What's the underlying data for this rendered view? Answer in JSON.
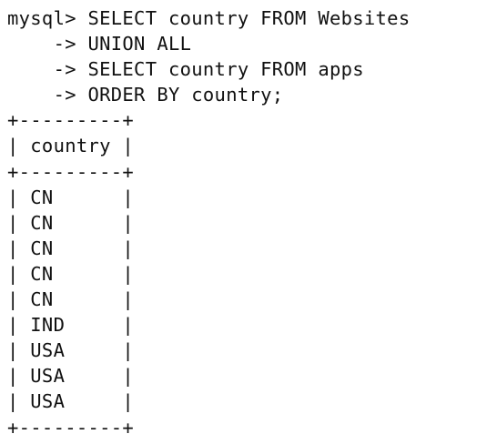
{
  "query_lines": [
    "mysql> SELECT country FROM Websites",
    "    -> UNION ALL",
    "    -> SELECT country FROM apps",
    "    -> ORDER BY country;"
  ],
  "table": {
    "border": "+---------+",
    "header_row": "| country |",
    "rows": [
      "| CN      |",
      "| CN      |",
      "| CN      |",
      "| CN      |",
      "| CN      |",
      "| IND     |",
      "| USA     |",
      "| USA     |",
      "| USA     |"
    ]
  }
}
